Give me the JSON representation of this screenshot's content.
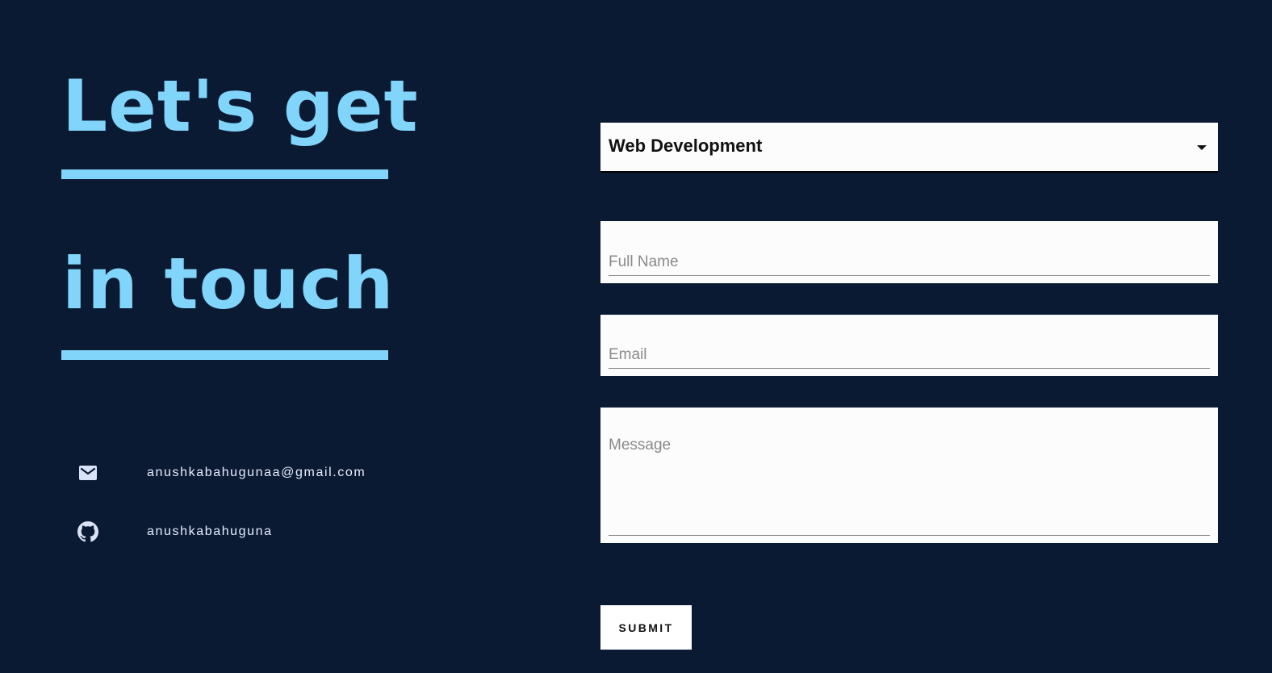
{
  "heading": {
    "line1": "Let's get",
    "line2": "in touch"
  },
  "contacts": {
    "email": {
      "icon": "mail-icon",
      "text": "anushkabahugunaa@gmail.com"
    },
    "github": {
      "icon": "github-icon",
      "text": "anushkabahuguna"
    }
  },
  "form": {
    "service_select": {
      "selected": "Web Development"
    },
    "full_name": {
      "placeholder": "Full Name",
      "value": ""
    },
    "email": {
      "placeholder": "Email",
      "value": ""
    },
    "message": {
      "placeholder": "Message",
      "value": ""
    },
    "submit_label": "SUBMIT"
  },
  "colors": {
    "background": "#0b1a33",
    "accent": "#81d4fa",
    "field_background": "#fcfcfc",
    "contact_text": "#e6eeff"
  }
}
